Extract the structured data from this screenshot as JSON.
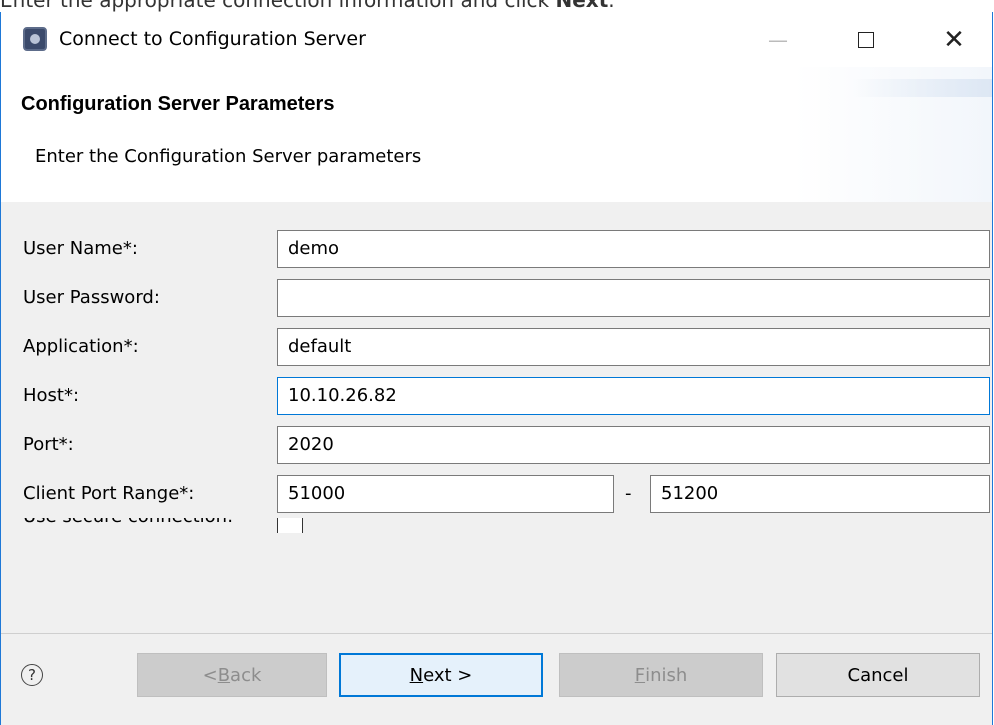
{
  "caption": {
    "text": "Enter the appropriate connection information and click ",
    "bold": "Next",
    "end": "."
  },
  "window": {
    "title": "Connect to Configuration Server",
    "minimize_glyph": "—",
    "close_glyph": "✕"
  },
  "header": {
    "title": "Configuration Server Parameters",
    "subtitle": "Enter the Configuration Server parameters"
  },
  "form": {
    "user_name": {
      "label": "User Name*:",
      "value": "demo"
    },
    "user_password": {
      "label": "User Password:",
      "value": ""
    },
    "application": {
      "label": "Application*:",
      "value": "default"
    },
    "host": {
      "label": "Host*:",
      "value": "10.10.26.82"
    },
    "port": {
      "label": "Port*:",
      "value": "2020"
    },
    "client_port_range": {
      "label": "Client Port Range*:",
      "from": "51000",
      "separator": "-",
      "to": "51200"
    },
    "partial_row_label": "Use secure connection:"
  },
  "buttons": {
    "help_glyph": "?",
    "back": {
      "prefix": "< ",
      "mnemonic": "B",
      "rest": "ack"
    },
    "next": {
      "mnemonic": "N",
      "rest": "ext >"
    },
    "finish": {
      "mnemonic": "F",
      "rest": "inish"
    },
    "cancel": "Cancel"
  },
  "colors": {
    "focus_border": "#0078d7",
    "window_border": "#1e78d7",
    "dialog_bg": "#f0f0f0"
  }
}
